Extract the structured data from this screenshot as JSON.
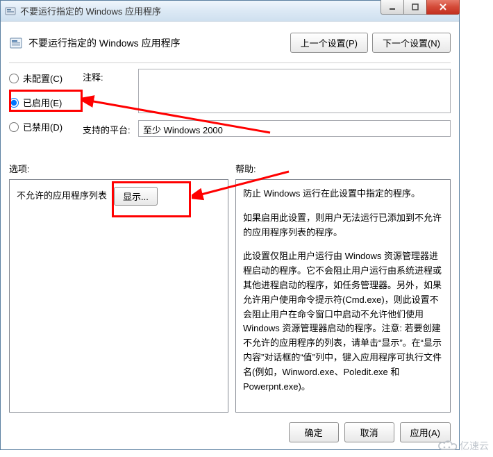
{
  "titlebar": {
    "title": "不要运行指定的 Windows 应用程序"
  },
  "header": {
    "title": "不要运行指定的 Windows 应用程序",
    "prev_btn": "上一个设置(P)",
    "next_btn": "下一个设置(N)"
  },
  "radios": {
    "not_configured": "未配置(C)",
    "enabled": "已启用(E)",
    "disabled": "已禁用(D)"
  },
  "fields": {
    "comment_label": "注释:",
    "comment_value": "",
    "platform_label": "支持的平台:",
    "platform_value": "至少 Windows 2000"
  },
  "sections": {
    "options_label": "选项:",
    "help_label": "帮助:"
  },
  "options": {
    "disallowed_list_label": "不允许的应用程序列表",
    "show_btn": "显示..."
  },
  "help": {
    "p1": "防止 Windows 运行在此设置中指定的程序。",
    "p2": "如果启用此设置，则用户无法运行已添加到不允许的应用程序列表的程序。",
    "p3": "此设置仅阻止用户运行由 Windows 资源管理器进程启动的程序。它不会阻止用户运行由系统进程或其他进程启动的程序，如任务管理器。另外，如果允许用户使用命令提示符(Cmd.exe)，则此设置不会阻止用户在命令窗口中启动不允许他们使用 Windows 资源管理器启动的程序。注意: 若要创建不允许的应用程序的列表，请单击“显示”。在“显示内容”对话框的“值”列中，键入应用程序可执行文件名(例如，Winword.exe、Poledit.exe 和 Powerpnt.exe)。"
  },
  "footer": {
    "ok": "确定",
    "cancel": "取消",
    "apply": "应用(A)"
  },
  "watermark": {
    "text": "亿速云"
  }
}
